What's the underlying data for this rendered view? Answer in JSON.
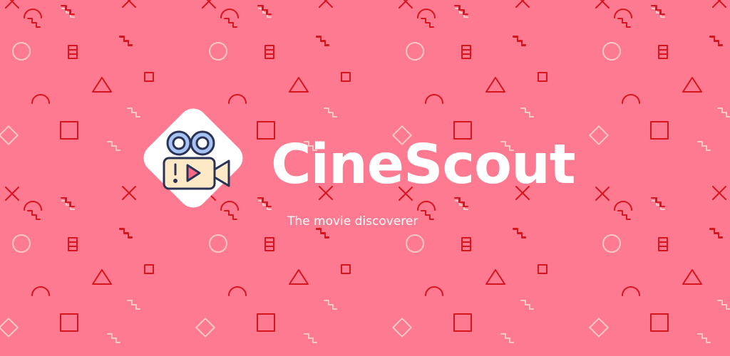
{
  "app": {
    "name": "CineScout",
    "tagline": "The movie discoverer"
  },
  "logo": {
    "icon": "movie-camera-icon",
    "tile_shape": "rounded-diamond"
  },
  "background": {
    "pattern": "memphis-geometric-shapes"
  },
  "colors": {
    "background": "#fd7a91",
    "text": "#ffffff",
    "shape_dark": "#d7151f",
    "shape_light": "#ffc8c8",
    "logo_tile": "#ffffff",
    "reel": "#a6c3f3",
    "reel_stroke": "#2a3355",
    "camera_body": "#fde9c6",
    "play_accent": "#f56a82"
  }
}
